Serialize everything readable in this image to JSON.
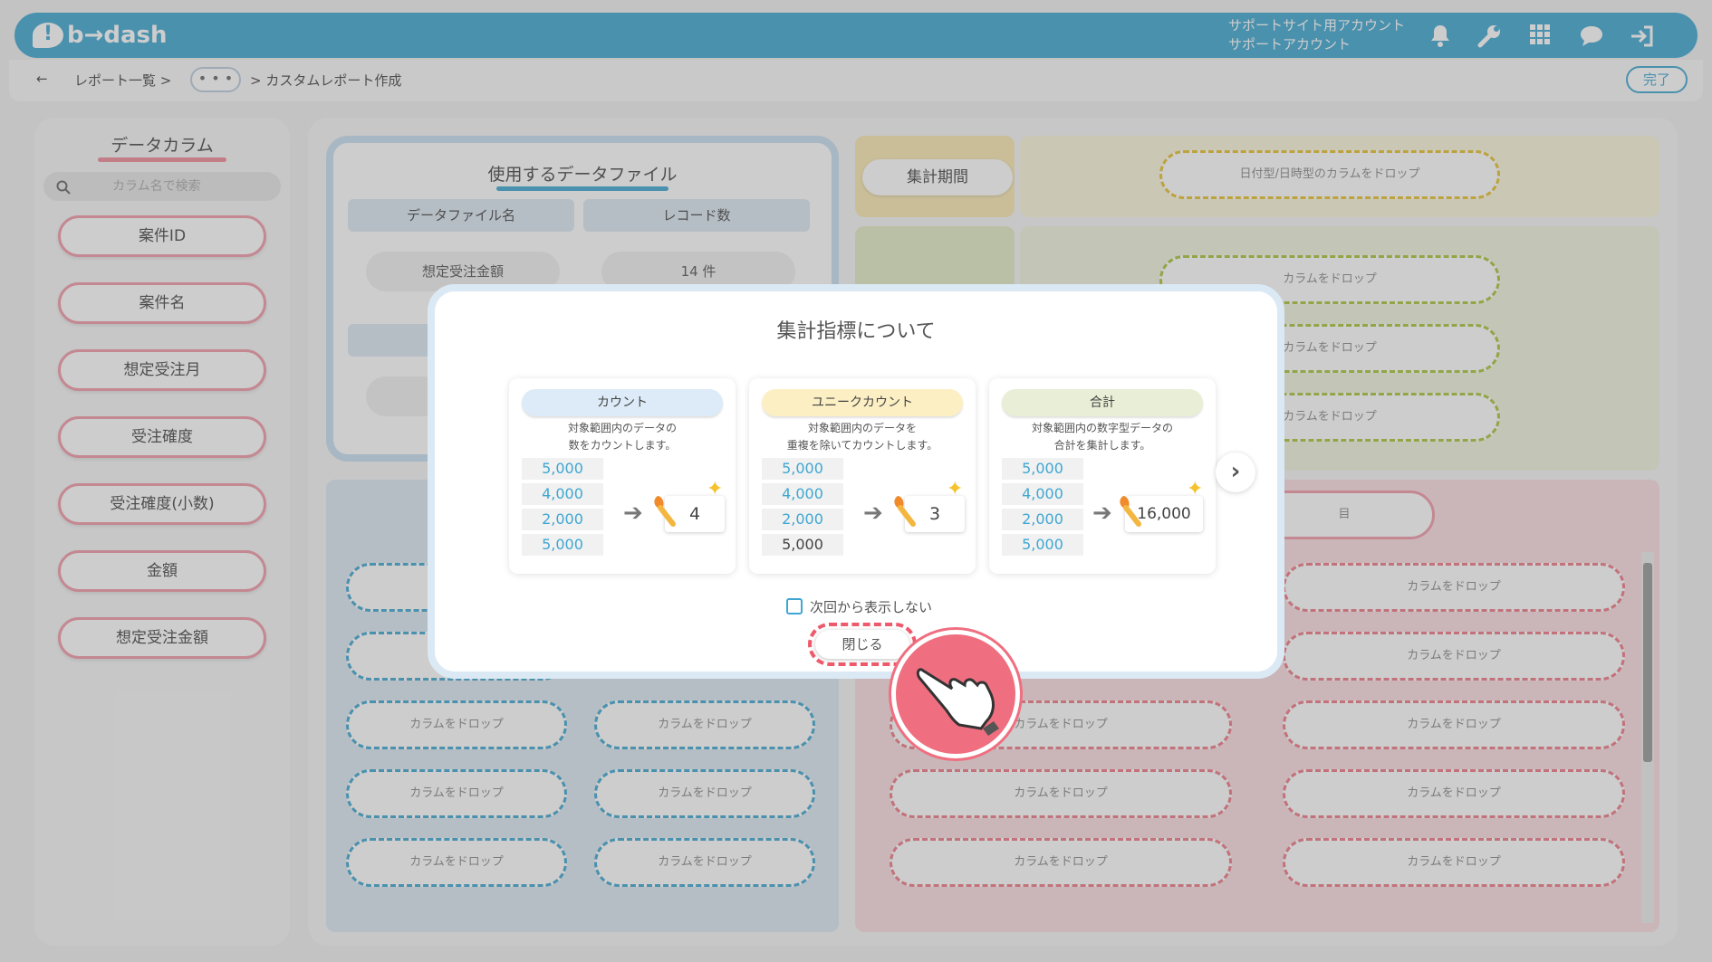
{
  "header": {
    "logo_text": "b→dash",
    "account_line1": "サポートサイト用アカウント",
    "account_line2": "サポートアカウント"
  },
  "breadcrumb": {
    "back": "←",
    "report_list": "レポート一覧 >",
    "dots": "• • •",
    "current": "> カスタムレポート作成",
    "done_label": "完了"
  },
  "sidebar": {
    "title": "データカラム",
    "search_placeholder": "カラム名で検索",
    "items": [
      "案件ID",
      "案件名",
      "想定受注月",
      "受注確度",
      "受注確度(小数)",
      "金額",
      "想定受注金額"
    ]
  },
  "file_panel": {
    "title": "使用するデータファイル",
    "col_name": "データファイル名",
    "col_count": "レコード数",
    "file_name": "想定受注金額",
    "record_count": "14 件"
  },
  "period": {
    "label": "集計期間",
    "drop_hint": "日付型/日時型のカラムをドロップ"
  },
  "drop_hint": "カラムをドロップ",
  "bg_fragments": {
    "blue_btn": "想",
    "drop_frag": "カラ",
    "red_frag": "目"
  },
  "modal": {
    "title": "集計指標について",
    "cards": [
      {
        "label": "カウント",
        "desc1": "対象範囲内のデータの",
        "desc2": "数をカウントします。",
        "values": [
          "5,000",
          "4,000",
          "2,000",
          "5,000"
        ],
        "result": "4",
        "color": "#dcebf7"
      },
      {
        "label": "ユニークカウント",
        "desc1": "対象範囲内のデータを",
        "desc2": "重複を除いてカウントします。",
        "values": [
          "5,000",
          "4,000",
          "2,000",
          "5,000"
        ],
        "result": "3",
        "color": "#fcefc4"
      },
      {
        "label": "合計",
        "desc1": "対象範囲内の数字型データの",
        "desc2": "合計を集計します。",
        "values": [
          "5,000",
          "4,000",
          "2,000",
          "5,000"
        ],
        "result": "16,000",
        "color": "#e8efd6"
      }
    ],
    "checkbox_label": "次回から表示しない",
    "close_label": "閉じる"
  }
}
